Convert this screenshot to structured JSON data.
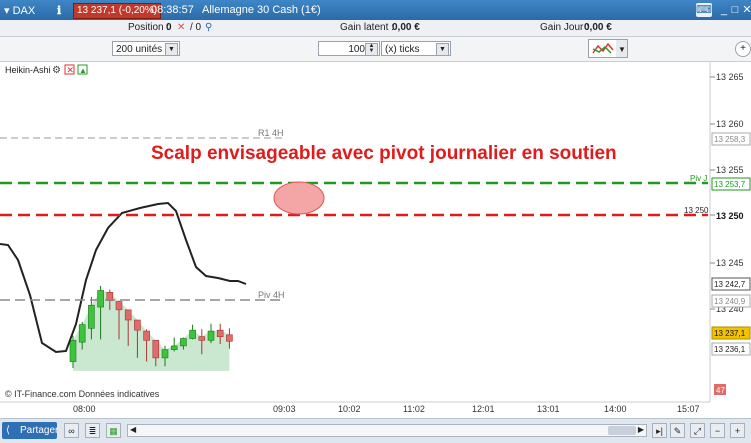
{
  "titlebar": {
    "symbol": "DAX",
    "price_change": "13 237,1 (-0,20%)",
    "time": "08:38:57",
    "instrument": "Allemagne 30 Cash (1€)"
  },
  "infobar": {
    "position_label": "Position :",
    "position_value": "0",
    "position_extra": "/ 0",
    "gain_latent_label": "Gain latent :",
    "gain_latent_value": "0,00 €",
    "gain_jour_label": "Gain Jour :",
    "gain_jour_value": "0,00 €"
  },
  "toolbar": {
    "units_select": "200 unités",
    "quantity_value": "100",
    "ticks_select": "(x) ticks"
  },
  "chart": {
    "indicator_label": "Heikin-Ashi",
    "annotation": "Scalp envisageable avec pivot journalier en soutien",
    "copyright": "© IT-Finance.com  Données indicatives",
    "y_ticks": [
      "13 265",
      "13 260",
      "13 255",
      "13 250",
      "13 245",
      "13 240"
    ],
    "x_ticks": [
      "08:00",
      "09:03",
      "10:02",
      "11:02",
      "12:01",
      "13:01",
      "14:00",
      "15:07"
    ],
    "levels": {
      "r1_label": "R1 4H",
      "r1_value": "13 258,3",
      "piv_j_label": "Piv J",
      "piv_j_value": "13 253,7",
      "red_line_label": "13 250",
      "red_line_value": "13 250",
      "piv4h_label": "Piv 4H",
      "piv4h_value": "13 240,9",
      "black_line_value": "13 242,7",
      "last_price": "13 237,1",
      "price_small": "13 236,1",
      "countdown": "47"
    },
    "colors": {
      "green_dashed": "#1e9a1e",
      "red_dashed": "#e01b1b",
      "annotation": "#e01b1b",
      "bull_candle": "#3cc43c",
      "bear_candle": "#e06b6b",
      "last_price_bg": "#f2c300"
    }
  },
  "bottombar": {
    "share_label": "Partager"
  },
  "chart_data": {
    "type": "line",
    "title": "",
    "x_ticks": [
      "08:00",
      "09:03",
      "10:02",
      "11:02",
      "12:01",
      "13:01",
      "14:00",
      "15:07"
    ],
    "y_range": [
      13233,
      13267
    ],
    "series": [
      {
        "name": "Piv J",
        "values": [
          13253.7
        ]
      },
      {
        "name": "R1 4H",
        "values": [
          13258.3
        ]
      },
      {
        "name": "Piv 4H",
        "values": [
          13240.9
        ]
      }
    ],
    "candles": [
      {
        "o": 13234.2,
        "c": 13236.5,
        "h": 13237.0,
        "l": 13233.5
      },
      {
        "o": 13236.3,
        "c": 13238.2,
        "h": 13238.5,
        "l": 13235.5
      },
      {
        "o": 13237.8,
        "c": 13240.3,
        "h": 13241.2,
        "l": 13236.6
      },
      {
        "o": 13240.1,
        "c": 13241.9,
        "h": 13242.4,
        "l": 13236.6
      },
      {
        "o": 13241.7,
        "c": 13240.8,
        "h": 13242.0,
        "l": 13239.8
      },
      {
        "o": 13240.7,
        "c": 13239.8,
        "h": 13240.8,
        "l": 13236.6
      },
      {
        "o": 13239.8,
        "c": 13238.7,
        "h": 13239.8,
        "l": 13235.9
      },
      {
        "o": 13238.7,
        "c": 13237.6,
        "h": 13238.6,
        "l": 13234.6
      },
      {
        "o": 13237.5,
        "c": 13236.5,
        "h": 13237.7,
        "l": 13234.2
      },
      {
        "o": 13236.5,
        "c": 13234.6,
        "h": 13236.4,
        "l": 13233.7
      },
      {
        "o": 13234.6,
        "c": 13235.5,
        "h": 13235.9,
        "l": 13233.7
      },
      {
        "o": 13235.5,
        "c": 13235.9,
        "h": 13236.8,
        "l": 13235.3
      },
      {
        "o": 13235.9,
        "c": 13236.7,
        "h": 13236.8,
        "l": 13235.5
      },
      {
        "o": 13236.7,
        "c": 13237.6,
        "h": 13238.2,
        "l": 13236.6
      },
      {
        "o": 13236.9,
        "c": 13236.5,
        "h": 13237.7,
        "l": 13235.0
      },
      {
        "o": 13236.5,
        "c": 13237.5,
        "h": 13238.3,
        "l": 13236.2
      },
      {
        "o": 13237.6,
        "c": 13236.9,
        "h": 13238.3,
        "l": 13236.1
      },
      {
        "o": 13237.1,
        "c": 13236.4,
        "h": 13237.8,
        "l": 13235.6
      }
    ]
  }
}
